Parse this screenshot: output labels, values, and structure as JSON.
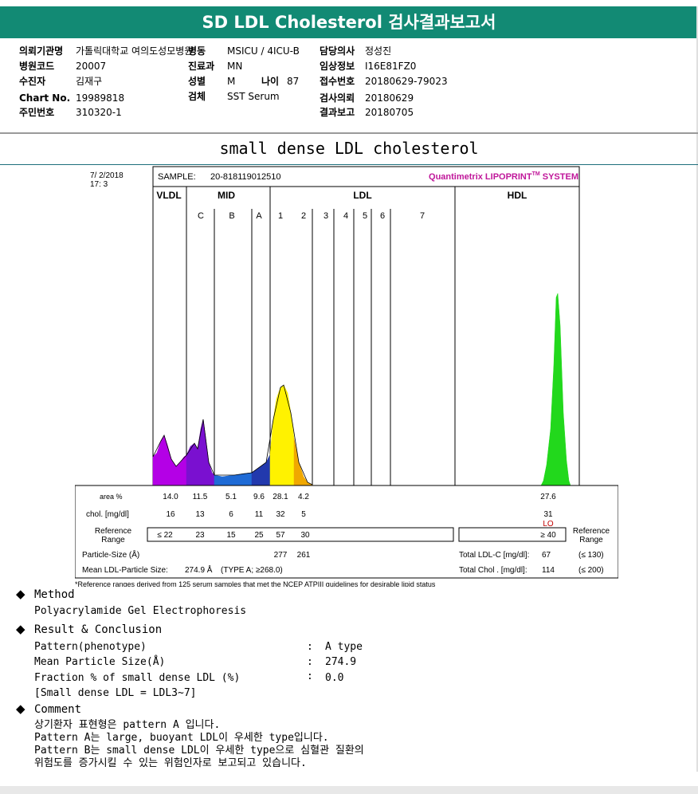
{
  "report_title": "SD LDL Cholesterol 검사결과보고서",
  "info": {
    "institution_label": "의뢰기관명",
    "institution_value": "가톨릭대학교 여의도성모병원",
    "ward_label": "병동",
    "ward_value": "MSICU / 4ICU-B",
    "doctor_label": "담당의사",
    "doctor_value": "정성진",
    "hospital_code_label": "병원코드",
    "hospital_code_value": "20007",
    "department_label": "진료과",
    "department_value": "MN",
    "clinical_info_label": "임상정보",
    "clinical_info_value": "I16E81FZ0",
    "patient_label": "수진자",
    "patient_value": "김재구",
    "sex_label": "성별",
    "sex_value": "M",
    "age_label": "나이",
    "age_value": "87",
    "receipt_label": "접수번호",
    "receipt_value": "20180629-79023",
    "chart_no_label": "Chart No.",
    "chart_no_value": "19989818",
    "specimen_label": "검체",
    "specimen_value": "SST Serum",
    "request_date_label": "검사의뢰",
    "request_date_value": "20180629",
    "id_label": "주민번호",
    "id_value": "310320-1",
    "report_date_label": "결과보고",
    "report_date_value": "20180705"
  },
  "section_title": "small dense LDL cholesterol",
  "chart_data": {
    "type": "area",
    "date": "7/ 2/2018",
    "time": "17: 3",
    "sample_label": "SAMPLE:",
    "sample_id": "20-818119012510",
    "system_brand": "Quantimetrix LIPOPRINT",
    "system_tm": "TM",
    "system_suffix": " SYSTEM",
    "groups": [
      "VLDL",
      "MID",
      "LDL",
      "HDL"
    ],
    "subbands": [
      "C",
      "B",
      "A",
      "1",
      "2",
      "3",
      "4",
      "5",
      "6",
      "7"
    ],
    "area_label": "area %",
    "area_values": [
      "14.0",
      "11.5",
      "5.1",
      "9.6",
      "28.1",
      "4.2",
      "27.6"
    ],
    "chol_label": "chol. [mg/dl]",
    "chol_values": [
      "16",
      "13",
      "6",
      "11",
      "32",
      "5",
      "31"
    ],
    "hdl_flag": "LO",
    "ref_label_1": "Reference",
    "ref_label_2": "Range",
    "ref_values": [
      "≤ 22",
      "23",
      "15",
      "25",
      "57",
      "30"
    ],
    "hdl_ref": "≥ 40",
    "particle_size_label": "Particle-Size (Å)",
    "particle_sizes": [
      "277",
      "261"
    ],
    "mean_ldl_label": "Mean LDL-Particle Size:",
    "mean_ldl_value": "274.9 Å",
    "mean_ldl_type": "(TYPE A; ≥268.0)",
    "total_ldl_label": "Total LDL-C [mg/dl]:",
    "total_ldl_value": "67",
    "total_ldl_ref": "(≤ 130)",
    "total_chol_label": "Total Chol . [mg/dl]:",
    "total_chol_value": "114",
    "total_chol_ref": "(≤ 200)",
    "footnote": "*Reference ranges derived from 125 serum samples that met the NCEP ATPIII guidelines for desirable lipid status",
    "colors": {
      "vldl": "#b400e6",
      "c": "#7a10d0",
      "b": "#1f6bd6",
      "a": "#2239ad",
      "ldl1": "#fff200",
      "ldl2": "#f0a800",
      "hdl": "#22d81c",
      "brand": "#c0179a",
      "lo": "#c00000"
    }
  },
  "method": {
    "title": "Method",
    "text": "Polyacrylamide Gel Electrophoresis"
  },
  "result": {
    "title": "Result & Conclusion",
    "rows": [
      {
        "label": "Pattern(phenotype)",
        "colon": ":",
        "value": "A type"
      },
      {
        "label": "Mean Particle Size(Å)",
        "colon": ":",
        "value": "274.9"
      },
      {
        "label": "Fraction % of small dense LDL (%)",
        "colon": ":",
        "value": "0.0"
      }
    ],
    "note": "[Small dense LDL = LDL3~7]"
  },
  "comment": {
    "title": "Comment",
    "lines": [
      "상기환자 표현형은 pattern A 입니다.",
      "Pattern A는 large, buoyant LDL이 우세한 type입니다.",
      "Pattern B는 small dense LDL이 우세한 type으로 심혈관 질환의",
      "위험도를 증가시킬 수 있는 위험인자로 보고되고 있습니다."
    ]
  }
}
